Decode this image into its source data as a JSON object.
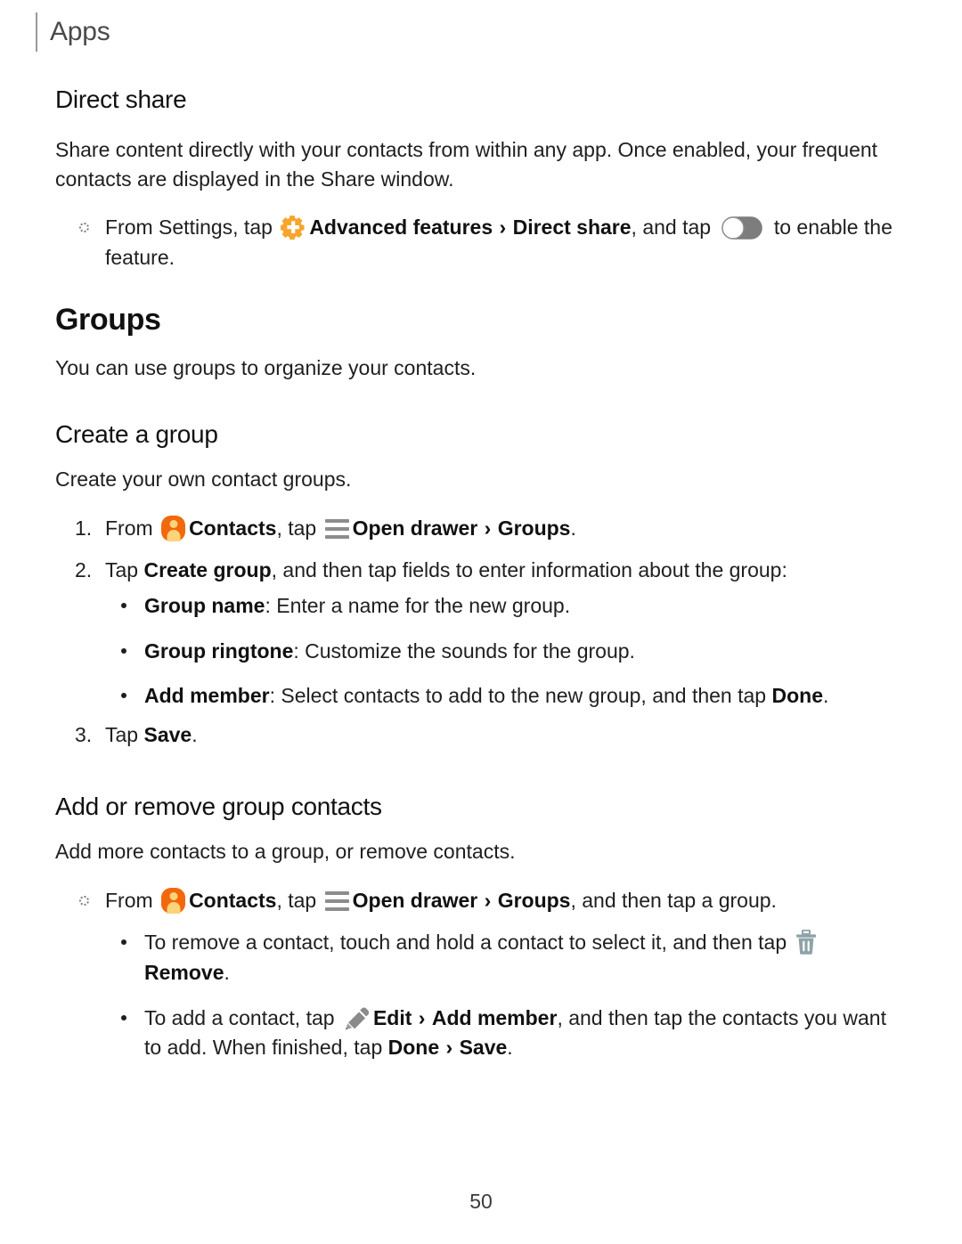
{
  "header": {
    "running_title": "Apps"
  },
  "sections": {
    "direct_share": {
      "heading": "Direct share",
      "intro": "Share content directly with your contacts from within any app. Once enabled, your frequent contacts are displayed in the Share window.",
      "step": {
        "text_1": "From Settings, tap ",
        "bold_1": "Advanced features",
        "chevron": "›",
        "bold_2": "Direct share",
        "text_2": ", and tap ",
        "text_3": " to enable the feature.",
        "icon_gear": "advanced-features-gear-icon",
        "icon_toggle": "toggle-switch-icon"
      }
    },
    "groups": {
      "heading": "Groups",
      "intro": "You can use groups to organize your contacts."
    },
    "create_group": {
      "heading": "Create a group",
      "intro": "Create your own contact groups.",
      "steps": [
        {
          "marker": "1.",
          "text_1": "From ",
          "bold_contacts": "Contacts",
          "text_2": ", tap ",
          "bold_drawer": "Open drawer",
          "chevron": "›",
          "bold_groups": "Groups",
          "text_3": "."
        },
        {
          "marker": "2.",
          "text_1": "Tap ",
          "bold_1": "Create group",
          "text_2": ", and then tap fields to enter information about the group:"
        },
        {
          "marker": "3.",
          "text_1": "Tap ",
          "bold_1": "Save",
          "text_2": "."
        }
      ],
      "fields": [
        {
          "bold": "Group name",
          "rest": ": Enter a name for the new group."
        },
        {
          "bold": "Group ringtone",
          "rest": ": Customize the sounds for the group."
        },
        {
          "bold_1": "Add member",
          "mid": ": Select contacts to add to the new group, and then tap ",
          "bold_2": "Done",
          "rest": "."
        }
      ]
    },
    "add_remove": {
      "heading": "Add or remove group contacts",
      "intro": "Add more contacts to a group, or remove contacts.",
      "step": {
        "text_1": "From ",
        "bold_contacts": "Contacts",
        "text_2": ", tap ",
        "bold_drawer": "Open drawer",
        "chevron": "›",
        "bold_groups": "Groups",
        "text_3": ", and then tap a group."
      },
      "bullets": [
        {
          "text_1": "To remove a contact, touch and hold a contact to select it, and then tap ",
          "bold_1": "Remove",
          "text_2": ".",
          "icon": "trash-icon"
        },
        {
          "text_1": "To add a contact, tap ",
          "bold_1": "Edit",
          "chevron": "›",
          "bold_2": "Add member",
          "text_2": ", and then tap the contacts you want to add. When finished, tap ",
          "bold_3": "Done",
          "chevron_2": "›",
          "bold_4": "Save",
          "text_3": ".",
          "icon": "pencil-edit-icon"
        }
      ]
    }
  },
  "footer": {
    "page_number": "50"
  },
  "colors": {
    "accent_orange": "#f2680c",
    "gear_amber": "#f6a62c",
    "trash_gray": "#8ea3a8",
    "pencil_gray": "#8a8a8a",
    "toggle_track": "#7d7d7d"
  }
}
